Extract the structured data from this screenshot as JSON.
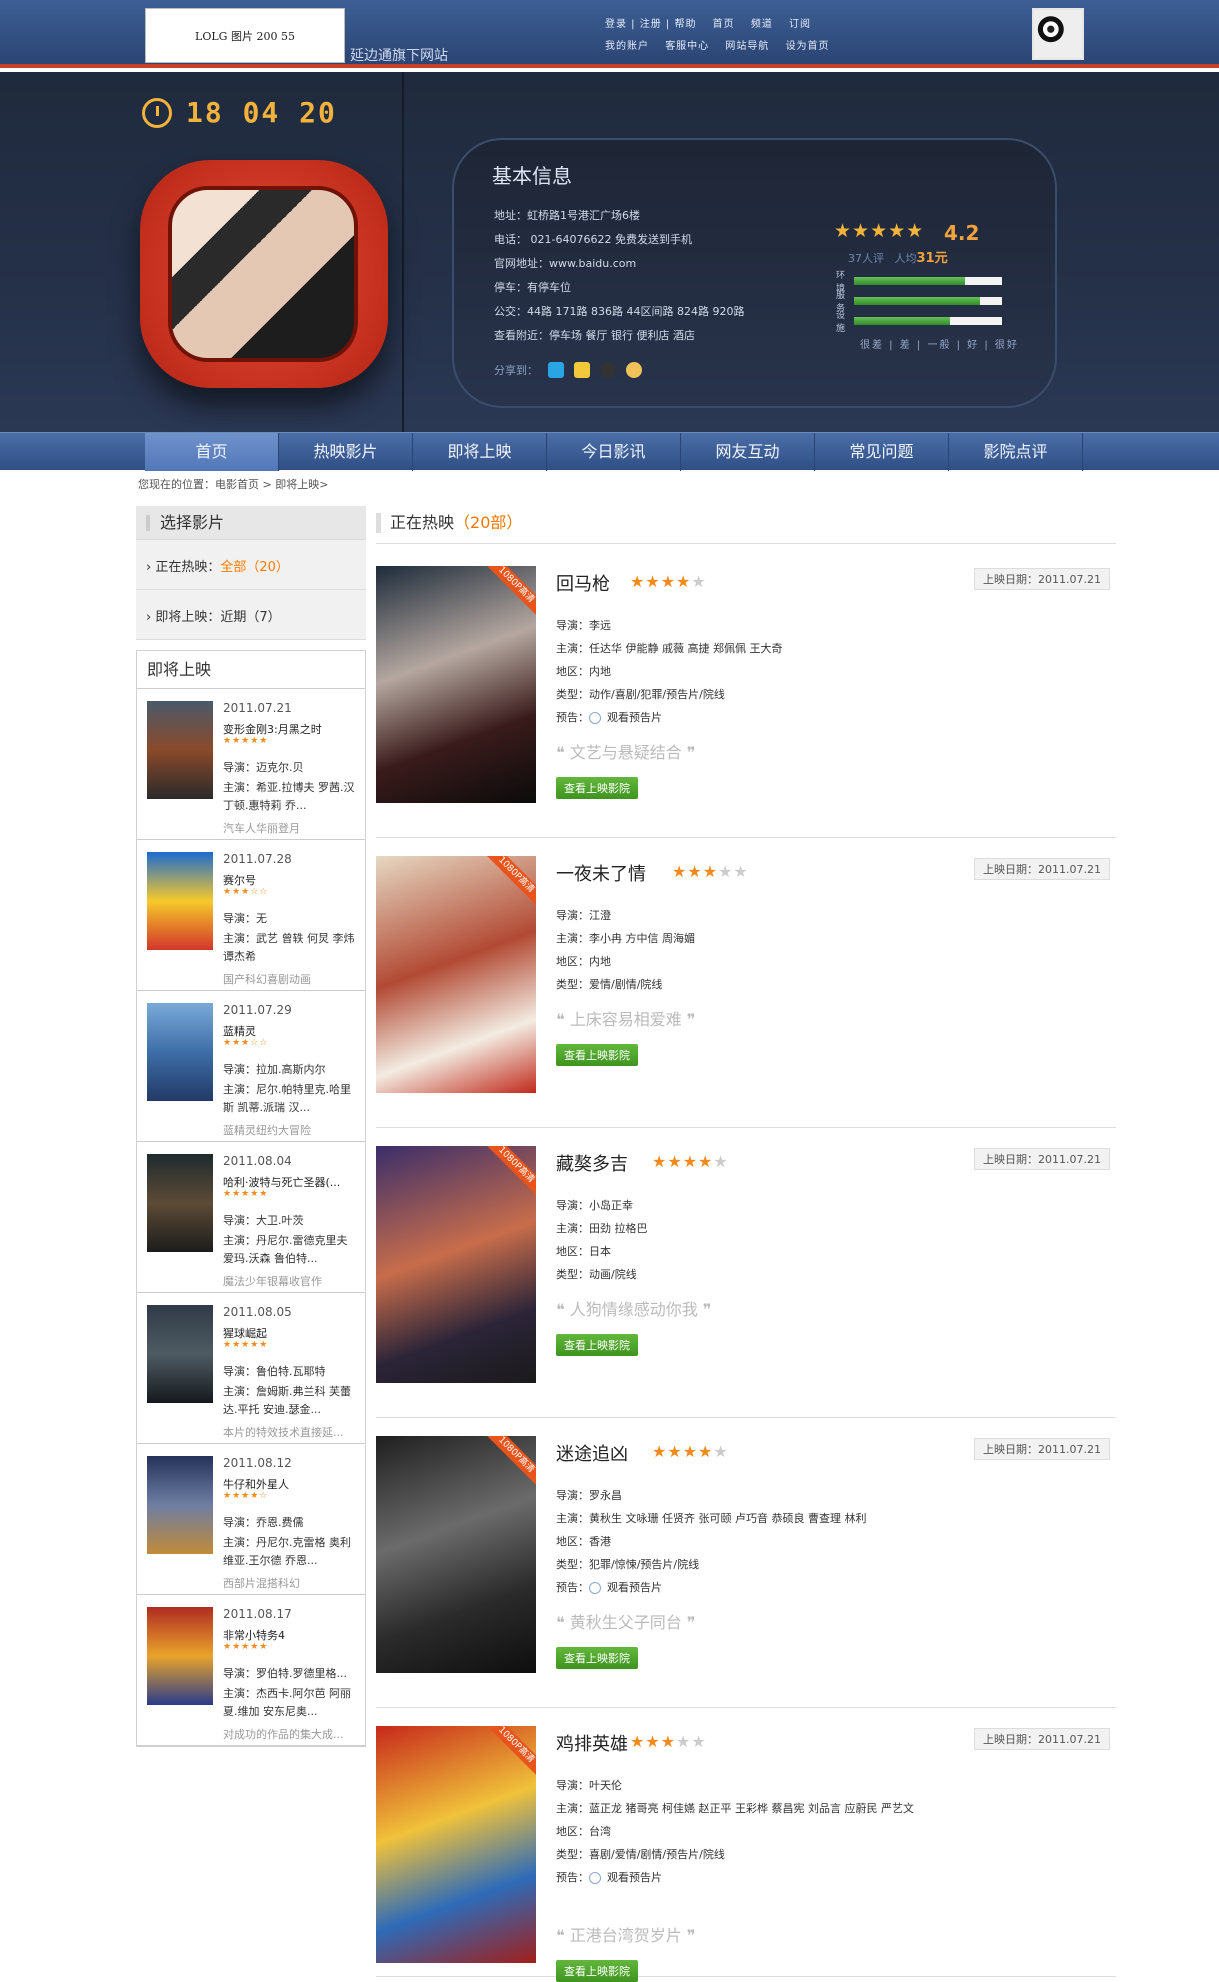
{
  "header": {
    "logo_text": "LOLG 图片 200 55",
    "site_subtitle": "延边通旗下网站",
    "top_menu": [
      "登录 | 注册 | 帮助",
      "首页",
      "频道",
      "订阅",
      "我的账户",
      "客服中心",
      "网站导航",
      "设为首页"
    ]
  },
  "hero": {
    "clock": "18 04 20",
    "info_title": "基本信息",
    "address": "地址：虹桥路1号港汇广场6楼",
    "phone": "电话： 021-64076622  免费发送到手机",
    "website": "官网地址：www.baidu.com",
    "parking": "停车：有停车位",
    "bus": "公交：44路  171路  836路  44区间路  824路  920路",
    "nearby": "查看附近：停车场  餐厅  银行  便利店  酒店",
    "share_label": "分享到：",
    "rating_score": "4.2",
    "reviews_count": "37",
    "reviews_label": "人评",
    "price_label": "人均",
    "price_value": "31元",
    "rating_bars": [
      {
        "label": "环境",
        "value": 0.75
      },
      {
        "label": "服务",
        "value": 0.85
      },
      {
        "label": "设施",
        "value": 0.65
      }
    ],
    "bar_scale": "很差 | 差 | 一般 | 好 | 很好"
  },
  "nav": [
    "首页",
    "热映影片",
    "即将上映",
    "今日影讯",
    "网友互动",
    "常见问题",
    "影院点评"
  ],
  "breadcrumb": "您现在的位置：电影首页 > 即将上映>",
  "sidebar": {
    "title": "选择影片",
    "now_showing_label": "正在热映：",
    "now_showing_filter": "全部（20）",
    "coming_label": "即将上映：",
    "coming_filter": "近期（7）",
    "upcoming_title": "即将上映",
    "items": [
      {
        "date": "2011.07.21",
        "title": "变形金刚3:月黑之时",
        "director": "导演：迈克尔.贝",
        "cast": "主演：希亚.拉博夫 罗茜.汉丁顿.惠特莉 乔...",
        "tagline": "汽车人华丽登月",
        "rating": 5
      },
      {
        "date": "2011.07.28",
        "title": "赛尔号",
        "director": "导演：无",
        "cast": "主演：武艺 曾轶 何炅 李炜 谭杰希",
        "tagline": "国产科幻喜剧动画",
        "rating": 3
      },
      {
        "date": "2011.07.29",
        "title": "蓝精灵",
        "director": "导演：拉加.高斯内尔",
        "cast": "主演：尼尔.帕特里克.哈里斯 凯蒂.派瑞 汉...",
        "tagline": "蓝精灵纽约大冒险",
        "rating": 3
      },
      {
        "date": "2011.08.04",
        "title": "哈利·波特与死亡圣器(...",
        "director": "导演：大卫.叶茨",
        "cast": "主演：丹尼尔.雷德克里夫 爱玛.沃森 鲁伯特...",
        "tagline": "魔法少年银幕收官作",
        "rating": 5
      },
      {
        "date": "2011.08.05",
        "title": "猩球崛起",
        "director": "导演：鲁伯特.瓦耶特",
        "cast": "主演：詹姆斯.弗兰科 芙蕾达.平托 安迪.瑟金...",
        "tagline": "本片的特效技术直接延...",
        "rating": 5
      },
      {
        "date": "2011.08.12",
        "title": "牛仔和外星人",
        "director": "导演：乔恩.费儒",
        "cast": "主演：丹尼尔.克雷格 奥利维亚.王尔德 乔恩...",
        "tagline": "西部片混搭科幻",
        "rating": 4
      },
      {
        "date": "2011.08.17",
        "title": "非常小特务4",
        "director": "导演：罗伯特.罗德里格...",
        "cast": "主演：杰西卡.阿尔芭 阿丽夏.维加 安东尼奥...",
        "tagline": "对成功的作品的集大成...",
        "rating": 5
      }
    ]
  },
  "main": {
    "heading": "正在热映",
    "heading_count": "（20部）",
    "date_label": "上映日期：",
    "director_label": "导演：",
    "cast_label": "主演：",
    "region_label": "地区：",
    "genre_label": "类型：",
    "trailer_label": "预告：",
    "trailer_link": "观看预告片",
    "button_label": "查看上映影院",
    "badge": "1080P高清",
    "movies": [
      {
        "title": "回马枪",
        "rating": 4,
        "date": "2011.07.21",
        "director": "李远",
        "cast": "任达华 伊能静 戚薇 高捷 郑佩佩 王大奇",
        "region": "内地",
        "genre": "动作/喜剧/犯罪/预告片/院线",
        "trailer": true,
        "quote": "文艺与悬疑结合"
      },
      {
        "title": "一夜未了情",
        "rating": 3,
        "date": "2011.07.21",
        "director": "江澄",
        "cast": "李小冉 方中信 周海媚",
        "region": "内地",
        "genre": "爱情/剧情/院线",
        "trailer": false,
        "quote": "上床容易相爱难"
      },
      {
        "title": "藏獒多吉",
        "rating": 4,
        "date": "2011.07.21",
        "director": "小岛正幸",
        "cast": "田劲 拉格巴",
        "region": "日本",
        "genre": "动画/院线",
        "trailer": false,
        "quote": "人狗情缘感动你我"
      },
      {
        "title": "迷途追凶",
        "rating": 4,
        "date": "2011.07.21",
        "director": "罗永昌",
        "cast": "黄秋生 文咏珊 任贤齐 张可颐 卢巧音 恭硕良 曹查理 林利",
        "region": "香港",
        "genre": "犯罪/惊悚/预告片/院线",
        "trailer": true,
        "quote": "黄秋生父子同台"
      },
      {
        "title": "鸡排英雄",
        "rating": 3,
        "date": "2011.07.21",
        "director": "叶天伦",
        "cast": "蓝正龙 猪哥亮 柯佳嬿 赵正平 王彩桦 蔡昌宪 刘品言 应蔚民 严艺文",
        "region": "台湾",
        "genre": "喜剧/爱情/剧情/预告片/院线",
        "trailer": true,
        "quote": "正港台湾贺岁片"
      }
    ]
  },
  "colors": {
    "accent": "#f07800",
    "nav_bg": "#3f5f96",
    "hero_bg": "#253149",
    "stars": "#f48a1c",
    "button": "#4fa12d"
  },
  "icons": [
    "clock-icon",
    "qq-share-icon",
    "weibo-share-icon",
    "star-icon",
    "play-icon"
  ]
}
